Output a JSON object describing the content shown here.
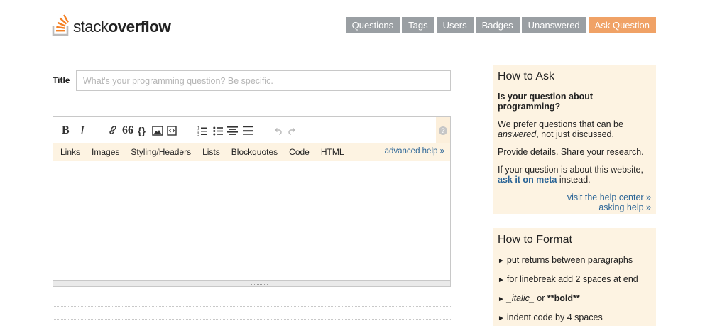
{
  "logo": {
    "text_thin": "stack",
    "text_bold": "overflow",
    "mark_color": "#f48024"
  },
  "nav": {
    "items": [
      {
        "label": "Questions"
      },
      {
        "label": "Tags"
      },
      {
        "label": "Users"
      },
      {
        "label": "Badges"
      },
      {
        "label": "Unanswered"
      },
      {
        "label": "Ask Question",
        "accent": "#f0a266"
      }
    ]
  },
  "form": {
    "title_label": "Title",
    "title_placeholder": "What's your programming question? Be specific.",
    "title_value": ""
  },
  "editor": {
    "toolbar": [
      "bold-icon",
      "italic-icon",
      "link-icon",
      "blockquote-icon",
      "code-icon",
      "image-icon",
      "snippet-icon",
      "ordered-list-icon",
      "bulleted-list-icon",
      "heading-icon",
      "horizontal-rule-icon",
      "undo-icon",
      "redo-icon",
      "help-icon"
    ],
    "toolbar_text": {
      "bold": "B",
      "italic": "I",
      "quote": "66",
      "code": "{}",
      "help": "?"
    },
    "help_links": [
      "Links",
      "Images",
      "Styling/Headers",
      "Lists",
      "Blockquotes",
      "Code",
      "HTML"
    ],
    "advanced_help": "advanced help »",
    "body_value": ""
  },
  "sidebar": {
    "how_to_ask": {
      "heading": "How to Ask",
      "question": "Is your question about programming?",
      "p1_a": "We prefer questions that can be",
      "p1_em": "answered",
      "p1_b": ", not just discussed.",
      "p2": "Provide details. Share your research.",
      "p3_a": "If your question is about this website,",
      "p3_link": "ask it on meta",
      "p3_b": " instead.",
      "link_help_center": "visit the help center »",
      "link_asking_help": "asking help »"
    },
    "how_to_format": {
      "heading": "How to Format",
      "rows": [
        "put returns between paragraphs",
        "for linebreak add 2 spaces at end",
        "indent code by 4 spaces"
      ],
      "italic_example": "_italic_",
      "or_text": " or ",
      "bold_example": "**bold**",
      "arrow": "►"
    }
  }
}
